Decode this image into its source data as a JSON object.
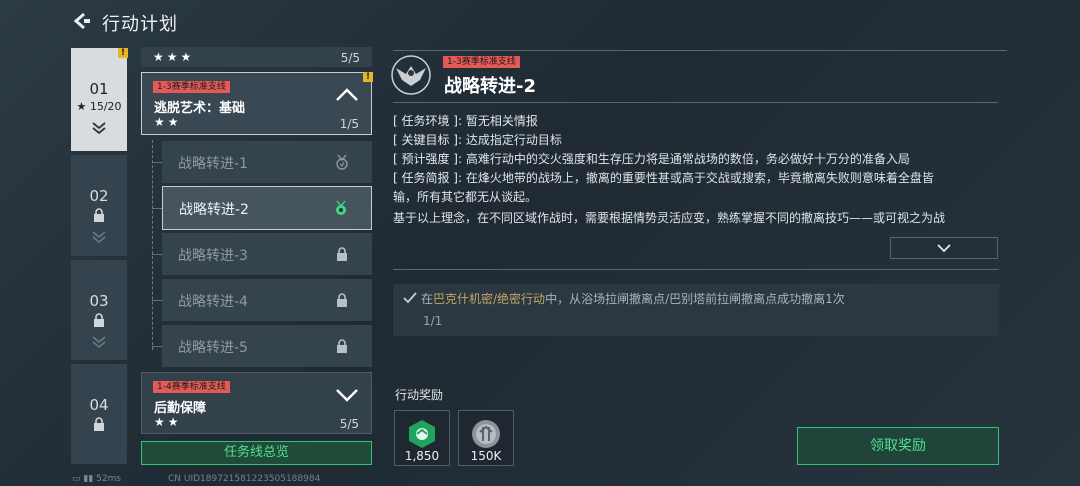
{
  "header": {
    "title": "行动计划"
  },
  "chapters": [
    {
      "num": "01",
      "progress": "15/20",
      "active": true
    },
    {
      "num": "02",
      "active": false
    },
    {
      "num": "03",
      "active": false
    },
    {
      "num": "04",
      "active": false
    }
  ],
  "tasks": {
    "top_stars": "★★★",
    "top_count": "5/5",
    "card1": {
      "tag": "1-3赛季标准支线",
      "name": "逃脱艺术：基础",
      "stars": "★★",
      "count": "1/5"
    },
    "subtasks": [
      "战略转进-1",
      "战略转进-2",
      "战略转进-3",
      "战略转进-4",
      "战略转进-5"
    ],
    "card2": {
      "tag": "1-4赛季标准支线",
      "name": "后勤保障",
      "stars": "★★",
      "count": "5/5"
    },
    "summary_btn": "任务线总览"
  },
  "detail": {
    "tag": "1-3赛季标准支线",
    "title": "战略转进-2",
    "env_k": "[ 任务环境 ]",
    "env_v": "暂无相关情报",
    "goal_k": "[ 关键目标 ]",
    "goal_v": "达成指定行动目标",
    "intensity_k": "[ 预计强度 ]",
    "intensity_v": "高难行动中的交火强度和生存压力将是通常战场的数倍，务必做好十万分的准备入局",
    "brief_k": "[ 任务简报 ]",
    "brief_v": "在烽火地带的战场上，撤离的重要性甚或高于交战或搜索，毕竟撤离失败则意味着全盘皆",
    "brief_v2": "输，所有其它都无从谈起。",
    "brief_v3": "基于以上理念，在不同区域作战时，需要根据情势灵活应变，熟练掌握不同的撤离技巧——或可视之为战"
  },
  "objective": {
    "pre": "在",
    "place": "巴克什机密/绝密行动",
    "post": "中，从浴场拉闸撤离点/巴别塔前拉闸撤离点成功撤离1次",
    "progress": "1/1"
  },
  "rewards": {
    "heading": "行动奖励",
    "items": [
      {
        "qty": "1,850",
        "icon": "experience-emblem-icon"
      },
      {
        "qty": "150K",
        "icon": "currency-coin-icon"
      }
    ],
    "claim_label": "领取奖励"
  },
  "status": {
    "ping": "52ms",
    "uid": "CN UID189721581223505188984"
  },
  "colors": {
    "accent_green": "#4fe08f",
    "tag_red": "#e35a57",
    "warn_yellow": "#e7b52c"
  }
}
